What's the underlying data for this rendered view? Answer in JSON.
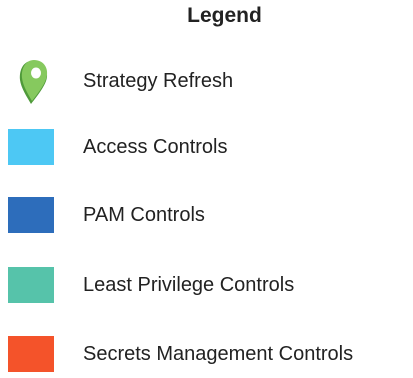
{
  "legend": {
    "title": "Legend",
    "items": [
      {
        "label": "Strategy Refresh",
        "marker": "map-pin-icon",
        "color": "#7cc35a"
      },
      {
        "label": "Access Controls",
        "marker": "square",
        "color": "#4dc8f4"
      },
      {
        "label": "PAM Controls",
        "marker": "square",
        "color": "#2d6dbb"
      },
      {
        "label": "Least Privilege Controls",
        "marker": "square",
        "color": "#56c3aa"
      },
      {
        "label": "Secrets Management Controls",
        "marker": "square",
        "color": "#f4532a"
      }
    ]
  }
}
